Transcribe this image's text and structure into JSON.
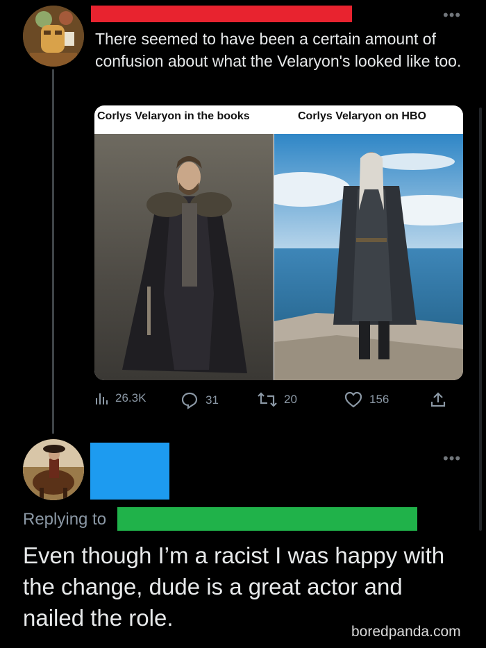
{
  "tweet1": {
    "text": "There seemed to have been a certain amount of confusion about what the Velaryon's looked like too.",
    "card": {
      "left_caption": "Corlys Velaryon in the books",
      "right_caption": "Corlys Velaryon on HBO"
    },
    "actions": {
      "views": "26.3K",
      "replies": "31",
      "retweets": "20",
      "likes": "156"
    },
    "more_icon": "more-horizontal-icon"
  },
  "tweet2": {
    "replying_label": "Replying to",
    "text": "Even though I’m a racist I was happy with the change, dude is a great actor and nailed the role.",
    "more_icon": "more-horizontal-icon"
  },
  "watermark": "boredpanda.com",
  "colors": {
    "background": "#000000",
    "redaction_red": "#e8232f",
    "redaction_blue": "#1d9bf0",
    "redaction_green": "#20b24a",
    "muted_text": "#8b98a5"
  }
}
